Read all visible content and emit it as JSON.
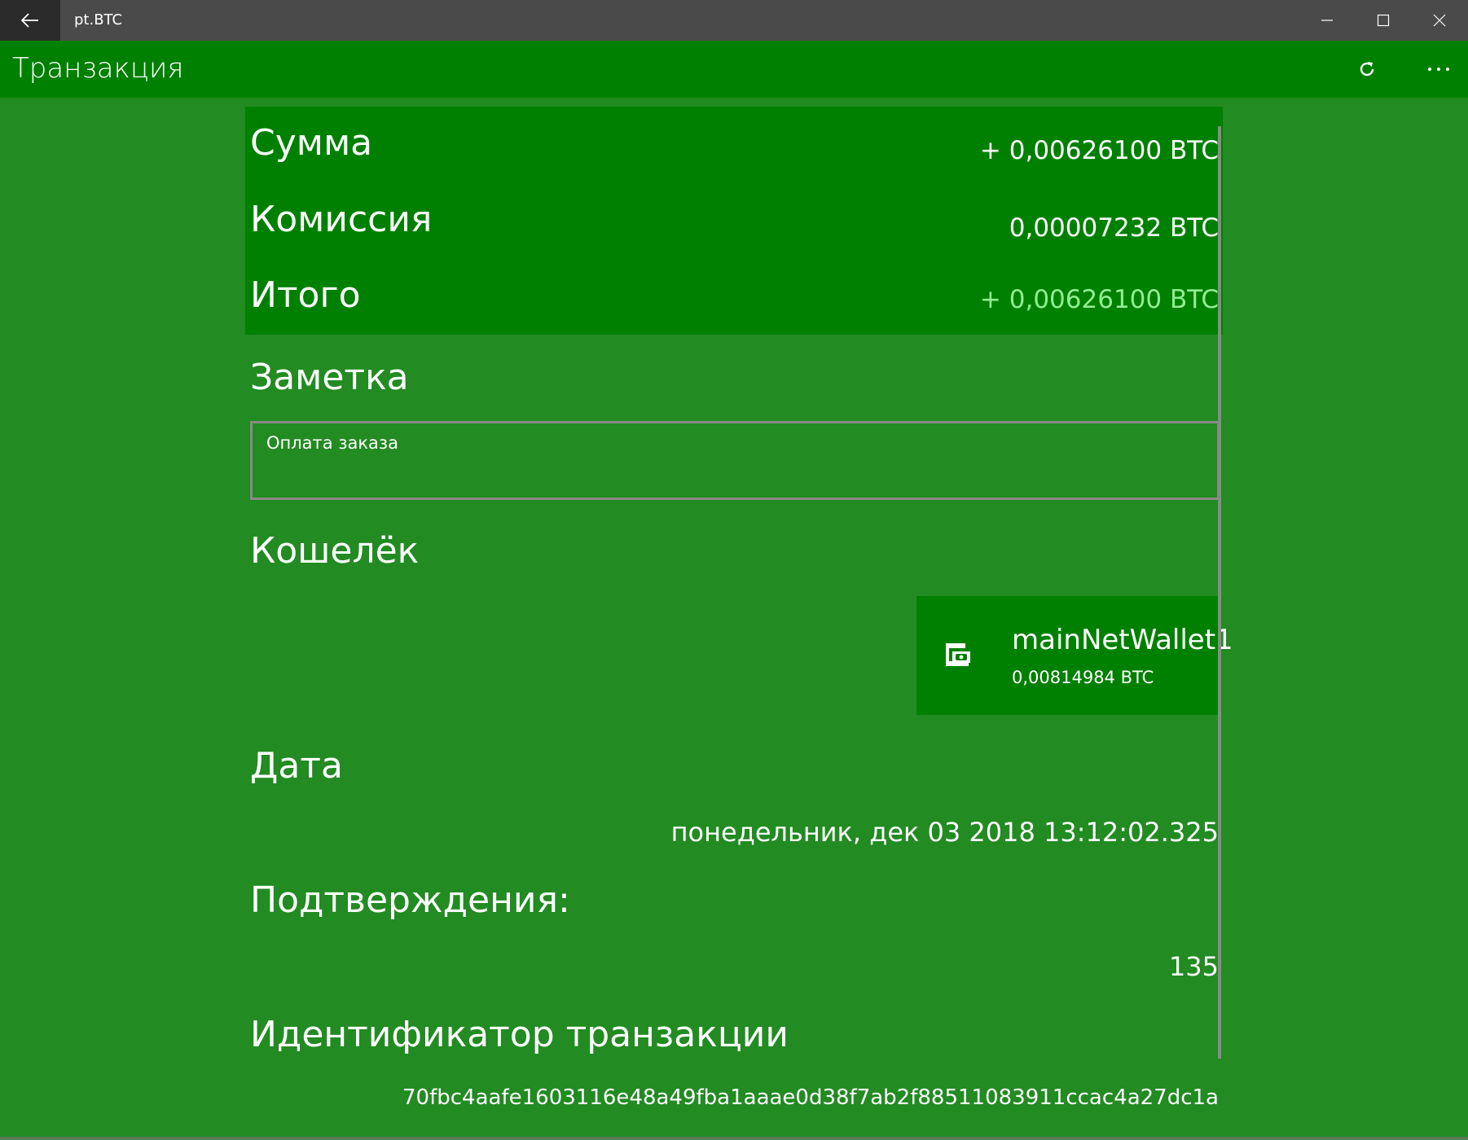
{
  "window": {
    "title": "pt.BTC",
    "back_icon": "back-arrow-icon",
    "controls": [
      "minimize-icon",
      "maximize-icon",
      "close-icon"
    ]
  },
  "appbar": {
    "title": "Транзакция",
    "refresh_icon": "refresh-icon",
    "more_icon": "more-icon"
  },
  "summary": {
    "amount_label": "Сумма",
    "amount_value": "+ 0,00626100 BTC",
    "fee_label": "Комиссия",
    "fee_value": "0,00007232 BTC",
    "total_label": "Итого",
    "total_value": "+ 0,00626100 BTC",
    "total_color": "#90EE90"
  },
  "note": {
    "label": "Заметка",
    "value": "Оплата заказа"
  },
  "wallet": {
    "label": "Кошелёк",
    "name": "mainNetWallet1",
    "balance": "0,00814984 BTC",
    "icon": "wallet-icon"
  },
  "date": {
    "label": "Дата",
    "value": "понедельник, дек 03 2018 13:12:02.325"
  },
  "confirmations": {
    "label": "Подтверждения:",
    "value": "135"
  },
  "txid": {
    "label": "Идентификатор транзакции",
    "value": "70fbc4aafe1603116e48a49fba1aaae0d38f7ab2f88511083911ccac4a27dc1a"
  },
  "colors": {
    "background": "#228B22",
    "panel": "#008000",
    "titlebar": "#4a4a4a"
  }
}
